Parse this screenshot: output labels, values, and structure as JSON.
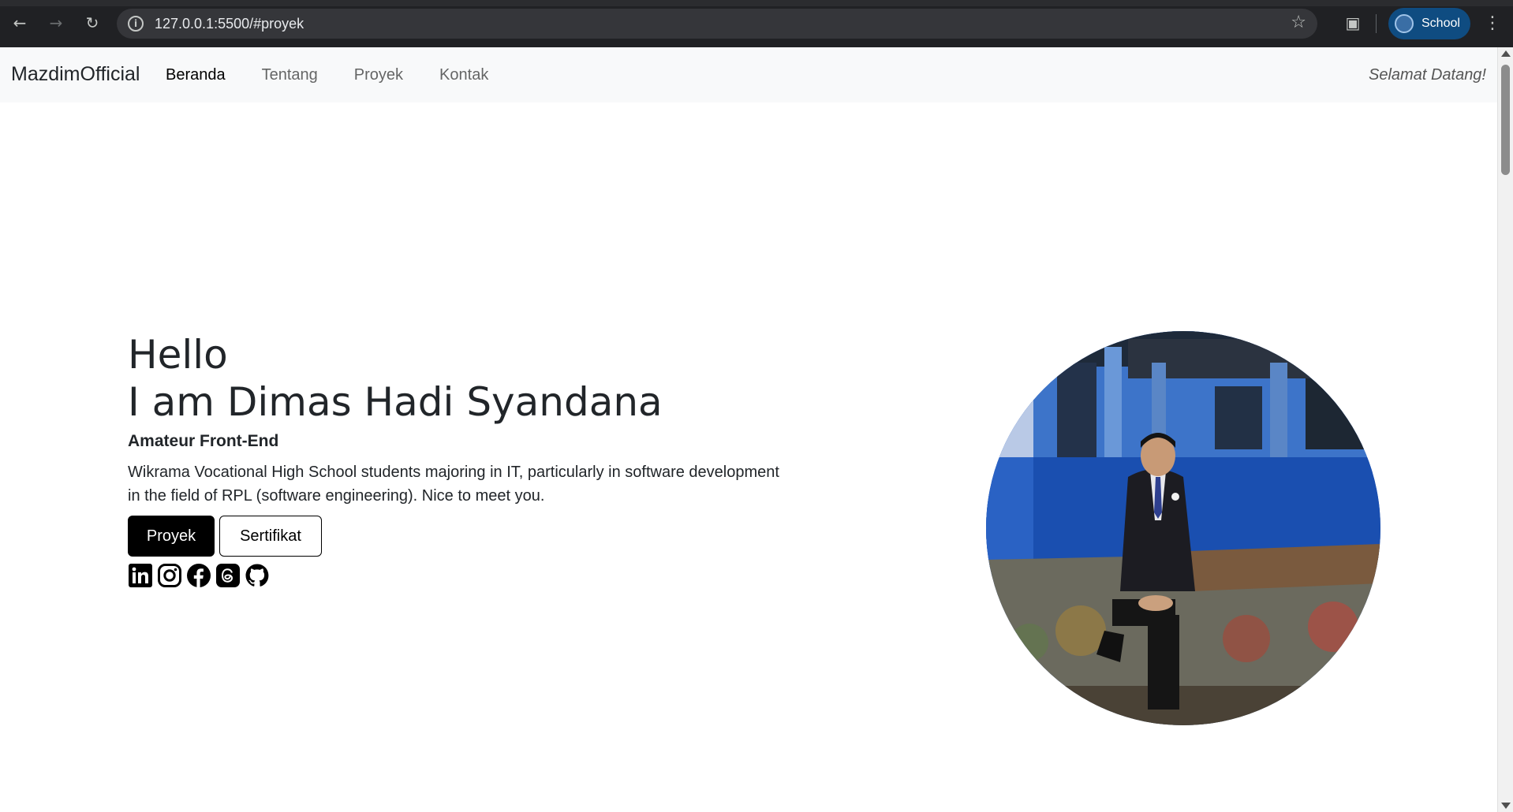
{
  "browser": {
    "url": "127.0.0.1:5500/#proyek",
    "profile_label": "School",
    "back_icon": "arrow-left-icon",
    "forward_icon": "arrow-right-icon",
    "reload_icon": "reload-icon"
  },
  "navbar": {
    "brand": "MazdimOfficial",
    "links": [
      "Beranda",
      "Tentang",
      "Proyek",
      "Kontak"
    ],
    "active_link": "Beranda",
    "welcome": "Selamat Datang!"
  },
  "hero": {
    "title_line1": "Hello",
    "title_line2": "I am Dimas Hadi Syandana",
    "subtitle": "Amateur Front-End",
    "description": "Wikrama Vocational High School students majoring in IT, particularly in software development in the field of RPL (software engineering). Nice to meet you.",
    "buttons": {
      "primary": "Proyek",
      "secondary": "Sertifikat"
    },
    "social_icons": [
      "linkedin-icon",
      "instagram-icon",
      "facebook-icon",
      "threads-icon",
      "github-icon"
    ]
  },
  "colors": {
    "navbar_bg": "#f8f9fa",
    "browser_bg": "#202124",
    "profile_chip": "#0f4c81",
    "primary_button": "#000000"
  }
}
